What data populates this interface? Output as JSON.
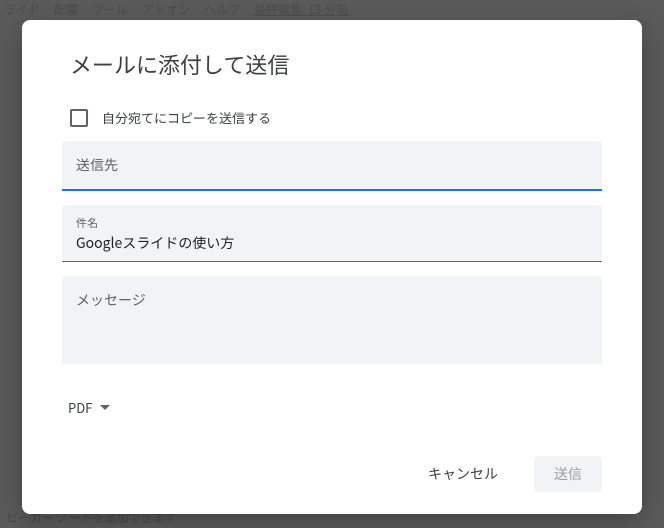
{
  "backdrop": {
    "menu_items": [
      "ライド",
      "配置",
      "ツール",
      "アドオン",
      "ヘルプ"
    ],
    "last_edit": "最終編集: 13 分前",
    "bottom_text": "ピーカー ノートを追加できます"
  },
  "dialog": {
    "title": "メールに添付して送信",
    "copy_to_self_label": "自分宛てにコピーを送信する",
    "to": {
      "placeholder": "送信先"
    },
    "subject": {
      "label": "件名",
      "value": "Googleスライドの使い方"
    },
    "message": {
      "placeholder": "メッセージ"
    },
    "format_selected": "PDF",
    "actions": {
      "cancel": "キャンセル",
      "send": "送信"
    }
  }
}
